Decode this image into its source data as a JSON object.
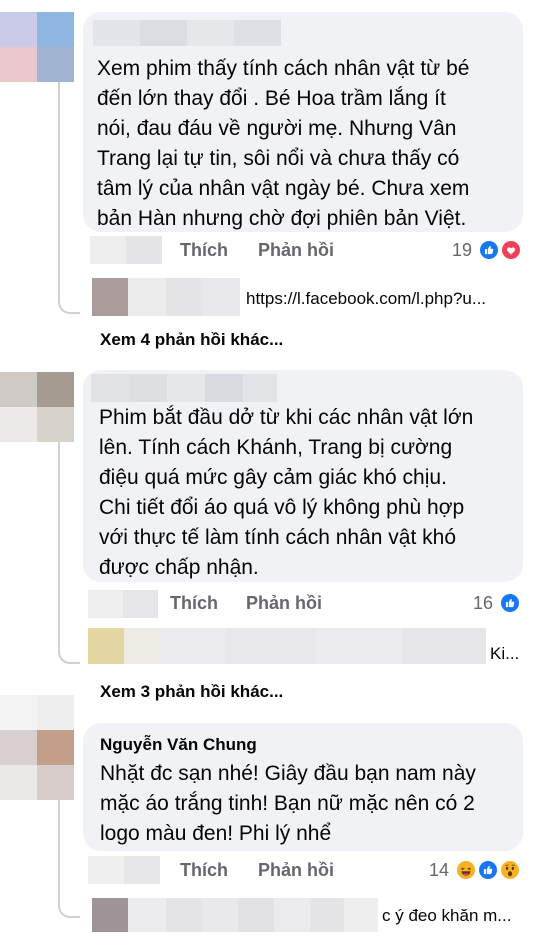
{
  "comments": [
    {
      "text": " Xem phim thấy tính cách nhân vật từ bé\nđến lớn thay đổi . Bé Hoa trầm lắng ít\nnói, đau đáu về người mẹ. Nhưng Vân\nTrang lại tự tin, sôi nổi và chưa thấy có\ntâm lý của nhân vật ngày bé. Chưa xem\nbản Hàn nhưng chờ đợi phiên bản Việt.",
      "like_label": "Thích",
      "reply_label": "Phản hồi",
      "reaction_count": "19",
      "reactions": [
        "like-icon",
        "love-icon"
      ],
      "reply_preview": "https://l.facebook.com/l.php?u...",
      "more_replies": "Xem 4 phản hồi khác..."
    },
    {
      "text": "Phim bắt đầu dở từ khi các nhân vật lớn\nlên. Tính cách Khánh, Trang bị cường\nđiệu quá mức gây cảm giác khó chịu.\nChi tiết đổi áo quá vô lý không phù hợp\nvới thực tế làm tính cách nhân vật khó\nđược chấp nhận.",
      "like_label": "Thích",
      "reply_label": "Phản hồi",
      "reaction_count": "16",
      "reactions": [
        "like-icon"
      ],
      "reply_preview": "Ki...",
      "more_replies": "Xem 3 phản hồi khác..."
    },
    {
      "author": "Nguyễn Văn Chung",
      "text": "Nhặt đc sạn nhé! Giây đầu bạn nam này\nmặc áo trắng tinh! Bạn nữ mặc nên có 2\nlogo màu đen! Phi lý nhể",
      "like_label": "Thích",
      "reply_label": "Phản hồi",
      "reaction_count": "14",
      "reactions": [
        "haha-icon",
        "like-icon",
        "wow-icon"
      ],
      "reply_preview": "c ý đeo khăn m..."
    }
  ],
  "colors": {
    "bubble": "#f0f2f5",
    "like": "#1877f2",
    "love": "#f33e58",
    "haha": "#f7b125",
    "secondary_text": "#65676b"
  }
}
